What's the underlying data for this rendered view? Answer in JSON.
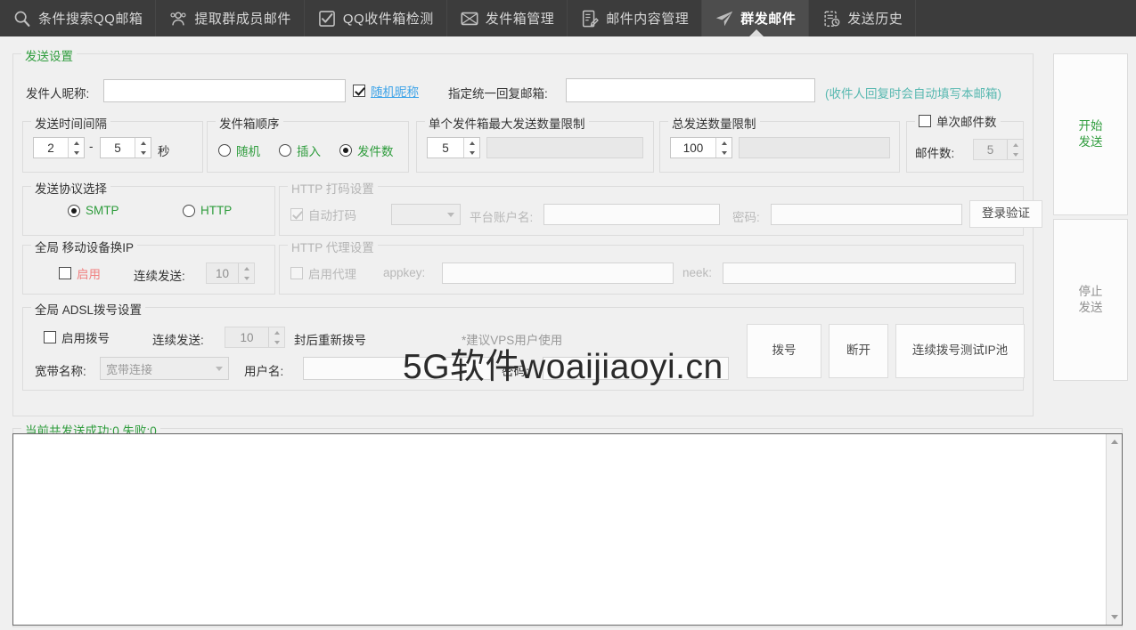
{
  "nav": {
    "tabs": [
      {
        "label": "条件搜索QQ邮箱",
        "icon": "search-icon",
        "active": false
      },
      {
        "label": "提取群成员邮件",
        "icon": "group-users-icon",
        "active": false
      },
      {
        "label": "QQ收件箱检测",
        "icon": "checkbox-check-icon",
        "active": false
      },
      {
        "label": "发件箱管理",
        "icon": "envelope-x-icon",
        "active": false
      },
      {
        "label": "邮件内容管理",
        "icon": "document-edit-icon",
        "active": false
      },
      {
        "label": "群发邮件",
        "icon": "paper-plane-icon",
        "active": true
      },
      {
        "label": "发送历史",
        "icon": "clipboard-clock-icon",
        "active": false
      }
    ]
  },
  "send_settings": {
    "title": "发送设置",
    "sender_nick_label": "发件人昵称:",
    "sender_nick_value": "",
    "random_nick_label": "随机昵称",
    "random_nick_checked": true,
    "reply_email_label": "指定统一回复邮箱:",
    "reply_email_value": "",
    "reply_hint": "(收件人回复时会自动填写本邮箱)"
  },
  "interval": {
    "title": "发送时间间隔",
    "min": "2",
    "dash": "-",
    "max": "5",
    "unit": "秒"
  },
  "outbox_order": {
    "title": "发件箱顺序",
    "options": [
      {
        "label": "随机",
        "selected": false
      },
      {
        "label": "插入",
        "selected": false
      },
      {
        "label": "发件数",
        "selected": true
      }
    ]
  },
  "single_limit": {
    "title": "单个发件箱最大发送数量限制",
    "value": "5",
    "extra_value": ""
  },
  "total_limit": {
    "title": "总发送数量限制",
    "value": "100",
    "extra_value": ""
  },
  "batch_count": {
    "title": "单次邮件数",
    "checked": false,
    "count_label": "邮件数:",
    "count_value": "5"
  },
  "protocol": {
    "title": "发送协议选择",
    "options": [
      {
        "label": "SMTP",
        "selected": true
      },
      {
        "label": "HTTP",
        "selected": false
      }
    ]
  },
  "http_captcha": {
    "title": "HTTP 打码设置",
    "auto_label": "自动打码",
    "auto_checked": true,
    "platform_select_value": "",
    "account_label": "平台账户名:",
    "account_value": "",
    "password_label": "密码:",
    "password_value": "",
    "login_button": "登录验证"
  },
  "mobile_ip": {
    "title": "全局 移动设备换IP",
    "enable_label": "启用",
    "enable_checked": false,
    "continuous_label": "连续发送:",
    "continuous_value": "10"
  },
  "http_proxy": {
    "title": "HTTP 代理设置",
    "enable_label": "启用代理",
    "enable_checked": false,
    "appkey_label": "appkey:",
    "appkey_value": "",
    "neek_label": "neek:",
    "neek_value": ""
  },
  "adsl": {
    "title": "全局 ADSL拨号设置",
    "enable_label": "启用拨号",
    "enable_checked": false,
    "continuous_label": "连续发送:",
    "continuous_value": "10",
    "redial_label": "封后重新拨号",
    "vps_hint": "*建议VPS用户使用",
    "broadband_label": "宽带名称:",
    "broadband_value": "宽带连接",
    "username_label": "用户名:",
    "username_value": "",
    "password_label": "密码:",
    "password_value": "",
    "dial_button": "拨号",
    "disconnect_button": "断开",
    "test_pool_button": "连续拨号测试IP池"
  },
  "actions": {
    "start_line1": "开始",
    "start_line2": "发送",
    "stop_line1": "停止",
    "stop_line2": "发送"
  },
  "status": {
    "text": "当前共发送成功:0,失败:0"
  },
  "log": {
    "value": ""
  },
  "watermark": {
    "text": "5G软件woaijiaoyi.cn"
  }
}
